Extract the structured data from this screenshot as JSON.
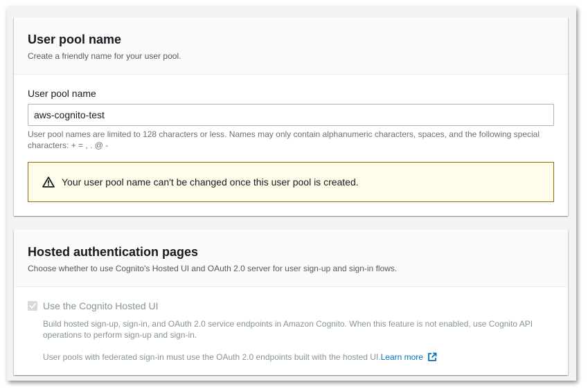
{
  "user_pool_section": {
    "title": "User pool name",
    "description": "Create a friendly name for your user pool.",
    "field_label": "User pool name",
    "field_value": "aws-cognito-test",
    "hint_line1": "User pool names are limited to 128 characters or less. Names may only contain alphanumeric characters, spaces, and the following special",
    "hint_line2": "characters: + = , . @ -",
    "alert_text": "Your user pool name can't be changed once this user pool is created.",
    "alert_icon": "warning-icon"
  },
  "hosted_section": {
    "title": "Hosted authentication pages",
    "description": "Choose whether to use Cognito's Hosted UI and OAuth 2.0 server for user sign-up and sign-in flows.",
    "checkbox_label": "Use the Cognito Hosted UI",
    "checkbox_checked": true,
    "desc_line1": "Build hosted sign-up, sign-in, and OAuth 2.0 service endpoints in Amazon Cognito. When this feature is not enabled, use Cognito API",
    "desc_line2": "operations to perform sign-up and sign-in.",
    "federated_text": "User pools with federated sign-in must use the OAuth 2.0 endpoints built with the hosted UI.",
    "learn_more": "Learn more",
    "learn_more_icon": "external-link-icon"
  },
  "colors": {
    "link": "#0073bb",
    "warning_border": "#906806",
    "warning_bg": "#fffce9"
  }
}
